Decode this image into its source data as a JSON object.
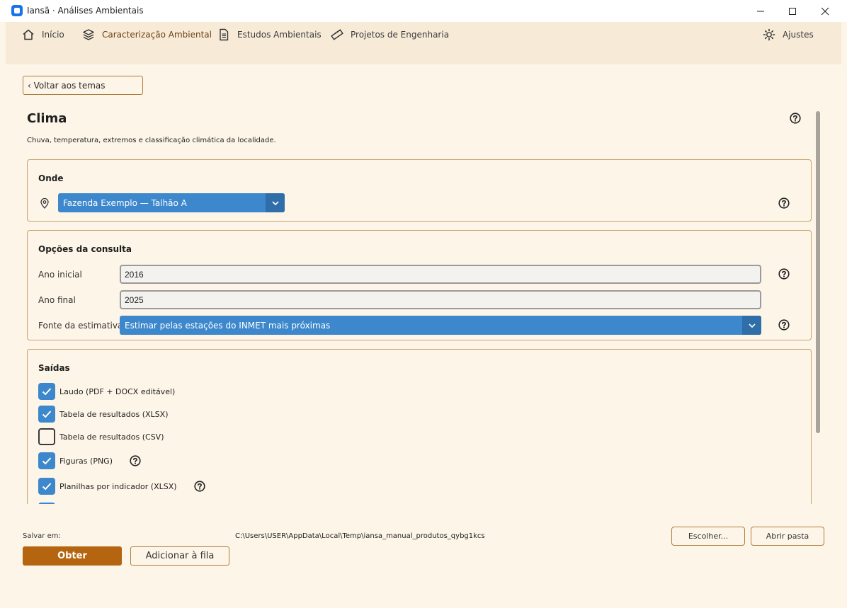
{
  "window": {
    "title": "Iansã · Análises Ambientais"
  },
  "nav": {
    "items": [
      {
        "label": "Início",
        "icon": "home-icon"
      },
      {
        "label": "Caracterização Ambiental",
        "icon": "layers-icon"
      },
      {
        "label": "Estudos Ambientais",
        "icon": "document-icon"
      },
      {
        "label": "Projetos de Engenharia",
        "icon": "ruler-icon"
      }
    ],
    "settings_label": "Ajustes",
    "active_index": 1
  },
  "back_button": "‹ Voltar aos temas",
  "page": {
    "title": "Clima",
    "description": "Chuva, temperatura, extremos e classificação climática da localidade."
  },
  "onde": {
    "title": "Onde",
    "location_value": "Fazenda Exemplo — Talhão A"
  },
  "opcoes": {
    "title": "Opções da consulta",
    "ano_inicial_label": "Ano inicial",
    "ano_inicial_value": "2016",
    "ano_final_label": "Ano final",
    "ano_final_value": "2025",
    "fonte_label": "Fonte da estimativa",
    "fonte_value": "Estimar pelas estações do INMET mais próximas"
  },
  "saidas": {
    "title": "Saídas",
    "items": [
      {
        "label": "Laudo (PDF + DOCX editável)",
        "checked": true
      },
      {
        "label": "Tabela de resultados (XLSX)",
        "checked": true
      },
      {
        "label": "Tabela de resultados (CSV)",
        "checked": false
      },
      {
        "label": "Figuras (PNG)",
        "checked": true
      },
      {
        "label": "Planilhas por indicador (XLSX)",
        "checked": true
      }
    ]
  },
  "footer": {
    "save_label": "Salvar em:",
    "save_path": "C:\\Users\\USER\\AppData\\Local\\Temp\\iansa_manual_produtos_qybg1kcs",
    "choose_label": "Escolher...",
    "open_folder_label": "Abrir pasta",
    "obter_label": "Obter",
    "queue_label": "Adicionar à fila"
  },
  "colors": {
    "accent": "#3d88cc",
    "primary_button": "#b5640f",
    "background": "#fdf5e8",
    "nav_background": "#f7ebd8",
    "border": "#c8a36e"
  }
}
